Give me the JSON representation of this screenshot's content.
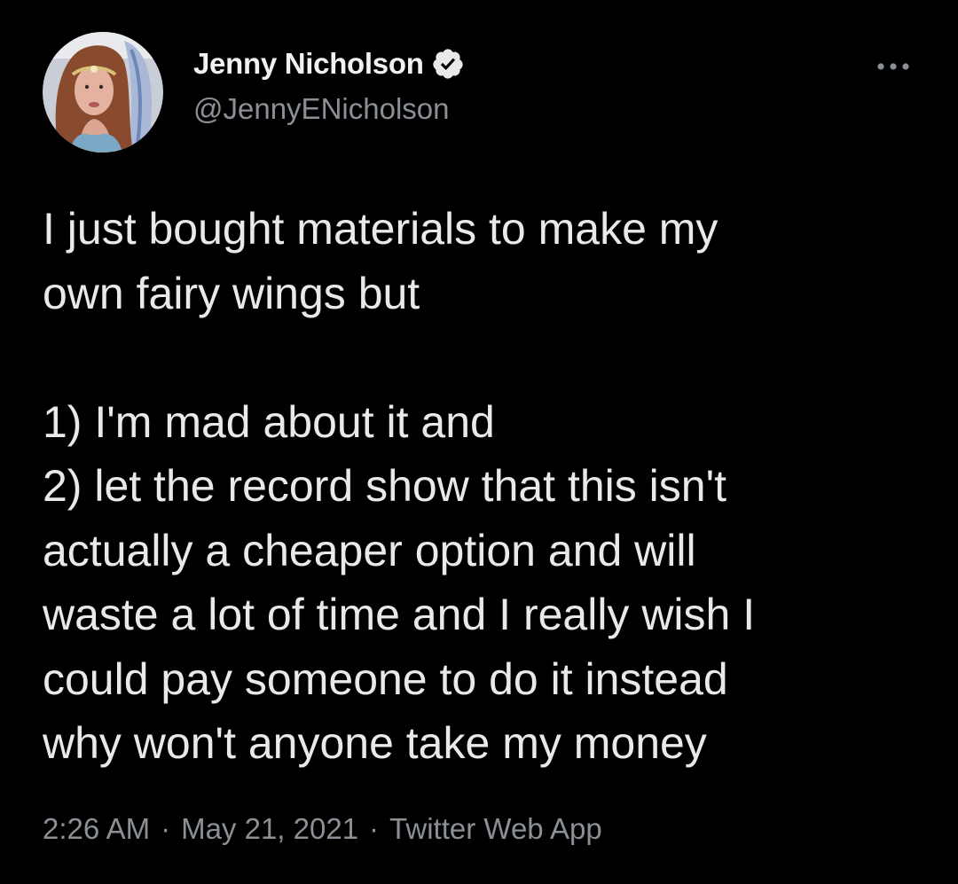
{
  "author": {
    "display_name": "Jenny Nicholson",
    "handle": "@JennyENicholson",
    "verified": true,
    "avatar_icon": "profile-photo"
  },
  "tweet": {
    "text": "I just bought materials to make my\nown fairy wings but\n\n1) I'm mad about it and\n2) let the record show that this isn't\nactually a cheaper option and will\nwaste a lot of time and I really wish I\ncould pay someone to do it instead\nwhy won't anyone take my money"
  },
  "meta": {
    "time": "2:26 AM",
    "date": "May 21, 2021",
    "source": "Twitter Web App",
    "separator": "·"
  },
  "icons": {
    "more": "more-horizontal-icon",
    "verified": "verified-badge-icon"
  },
  "colors": {
    "background": "#000000",
    "primary_text": "#e7e9ea",
    "secondary_text": "#8b9096",
    "badge": "#e7e9ea"
  }
}
